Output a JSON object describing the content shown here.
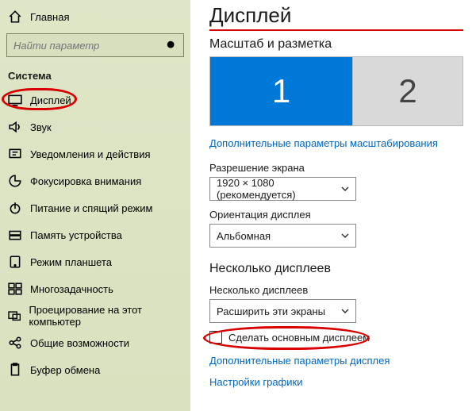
{
  "sidebar": {
    "home": "Главная",
    "search_placeholder": "Найти параметр",
    "section": "Система",
    "items": [
      {
        "icon": "display",
        "label": "Дисплей"
      },
      {
        "icon": "sound",
        "label": "Звук"
      },
      {
        "icon": "notify",
        "label": "Уведомления и действия"
      },
      {
        "icon": "focus",
        "label": "Фокусировка внимания"
      },
      {
        "icon": "power",
        "label": "Питание и спящий режим"
      },
      {
        "icon": "storage",
        "label": "Память устройства"
      },
      {
        "icon": "tablet",
        "label": "Режим планшета"
      },
      {
        "icon": "multi",
        "label": "Многозадачность"
      },
      {
        "icon": "project",
        "label": "Проецирование на этот компьютер"
      },
      {
        "icon": "shared",
        "label": "Общие возможности"
      },
      {
        "icon": "clip",
        "label": "Буфер обмена"
      }
    ]
  },
  "main": {
    "title": "Дисплей",
    "scale_head": "Масштаб и разметка",
    "display1": "1",
    "display2": "2",
    "link_scale": "Дополнительные параметры масштабирования",
    "res_label": "Разрешение экрана",
    "res_value": "1920 × 1080 (рекомендуется)",
    "orient_label": "Ориентация дисплея",
    "orient_value": "Альбомная",
    "multi_head": "Несколько дисплеев",
    "multi_label": "Несколько дисплеев",
    "multi_value": "Расширить эти экраны",
    "make_primary": "Сделать основным дисплеем",
    "link_display": "Дополнительные параметры дисплея",
    "link_graphics": "Настройки графики"
  }
}
